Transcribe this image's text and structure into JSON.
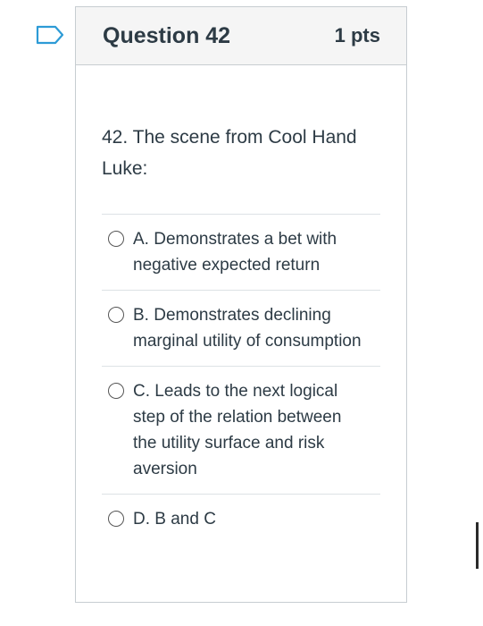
{
  "question": {
    "title": "Question 42",
    "points": "1 pts",
    "text": "42. The scene from Cool Hand Luke:"
  },
  "answers": [
    {
      "label": "A. Demonstrates a bet with negative expected return"
    },
    {
      "label": "B. Demonstrates declining marginal utility of consumption"
    },
    {
      "label": "C. Leads to the next logical step of the relation between the utility surface and risk aversion"
    },
    {
      "label": "D. B and C"
    }
  ],
  "colors": {
    "flag_outline": "#2d9bd6",
    "text": "#2d3b45",
    "header_bg": "#f5f5f5",
    "border": "#c7cdd1"
  },
  "icons": {
    "flag": "bookmark-flag-icon",
    "radio": "radio-unchecked-icon"
  }
}
